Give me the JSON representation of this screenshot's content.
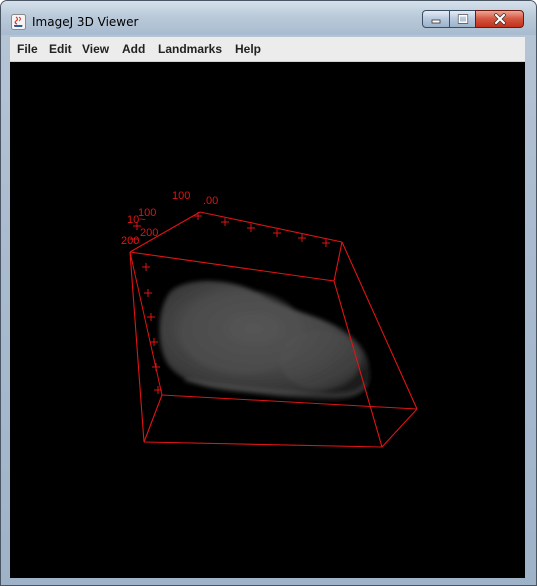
{
  "window": {
    "title": "ImageJ 3D Viewer",
    "controls": {
      "minimize_icon": "minimize-icon",
      "maximize_icon": "maximize-icon",
      "close_icon": "close-icon"
    }
  },
  "menubar": {
    "items": [
      {
        "label": "File"
      },
      {
        "label": "Edit"
      },
      {
        "label": "View"
      },
      {
        "label": "Add"
      },
      {
        "label": "Landmarks"
      },
      {
        "label": "Help"
      }
    ]
  },
  "viewer": {
    "background_color": "#000000",
    "bounding_box_color": "#e01414",
    "object_color": "#4a4a4a",
    "tick_labels": {
      "top_axis": [
        "100",
        ".00"
      ],
      "left_axis_upper": [
        "100",
        "10~"
      ],
      "left_axis_lower": [
        "200",
        "200"
      ]
    }
  }
}
